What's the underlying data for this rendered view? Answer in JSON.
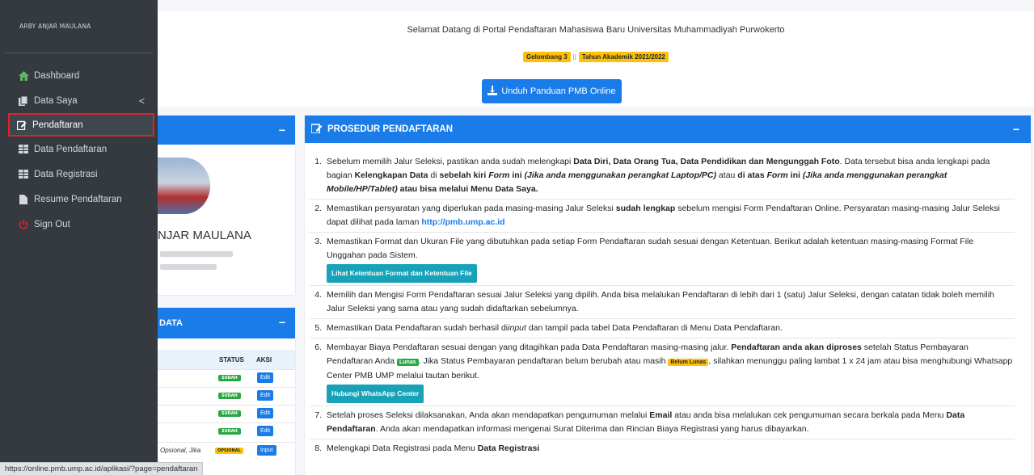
{
  "sidebar": {
    "user_name": "ARBY ANJAR MAULANA",
    "items": [
      {
        "label": "Dashboard",
        "icon": "home-icon",
        "color": "#5cb85c"
      },
      {
        "label": "Data Saya",
        "icon": "files-icon"
      },
      {
        "label": "Pendaftaran",
        "icon": "edit-icon"
      },
      {
        "label": "Data Pendaftaran",
        "icon": "table-icon"
      },
      {
        "label": "Data Registrasi",
        "icon": "table-icon"
      },
      {
        "label": "Resume Pendaftaran",
        "icon": "file-icon"
      },
      {
        "label": "Sign Out",
        "icon": "power-icon",
        "color": "#e3202c"
      }
    ],
    "chevron": "<"
  },
  "header": {
    "welcome": "Selamat Datang di Portal Pendaftaran Mahasiswa Baru Universitas Muhammadiyah Purwokerto",
    "badge_gelombang": "Gelombang 3",
    "separator": "||",
    "badge_tahun": "Tahun Akademik 2021/2022",
    "download_button": "Unduh Panduan PMB Online"
  },
  "profile": {
    "name": "NJAR MAULANA",
    "collapse": "−"
  },
  "data_card": {
    "title": "DATA",
    "collapse": "−",
    "col_status": "STATUS",
    "col_aksi": "AKSI",
    "rows": [
      {
        "status": "SUDAH",
        "action": "Edit"
      },
      {
        "status": "SUDAH",
        "action": "Edit"
      },
      {
        "status": "SUDAH",
        "action": "Edit"
      },
      {
        "status": "SUDAH",
        "action": "Edit"
      },
      {
        "note": "Opsional, Jika",
        "status": "OPSIONAL",
        "action": "Input"
      }
    ]
  },
  "procedure": {
    "title": "PROSEDUR PENDAFTARAN",
    "collapse": "−",
    "btn_format": "Lihat Ketentuan Format dan Ketentuan File",
    "btn_whatsapp": "Hubungi WhatsApp Center",
    "link_pmb": "http://pmb.ump.ac.id",
    "badge_lunas": "Lunas",
    "badge_belum": "Belum Lunas"
  },
  "statusbar": {
    "url": "https://online.pmb.ump.ac.id/aplikasi/?page=pendaftaran"
  },
  "colors": {
    "primary": "#1a7ce8",
    "sidebar": "#343a40",
    "highlight": "#e3202c",
    "success": "#28a745",
    "warning": "#ffc107",
    "info": "#17a2b8"
  }
}
